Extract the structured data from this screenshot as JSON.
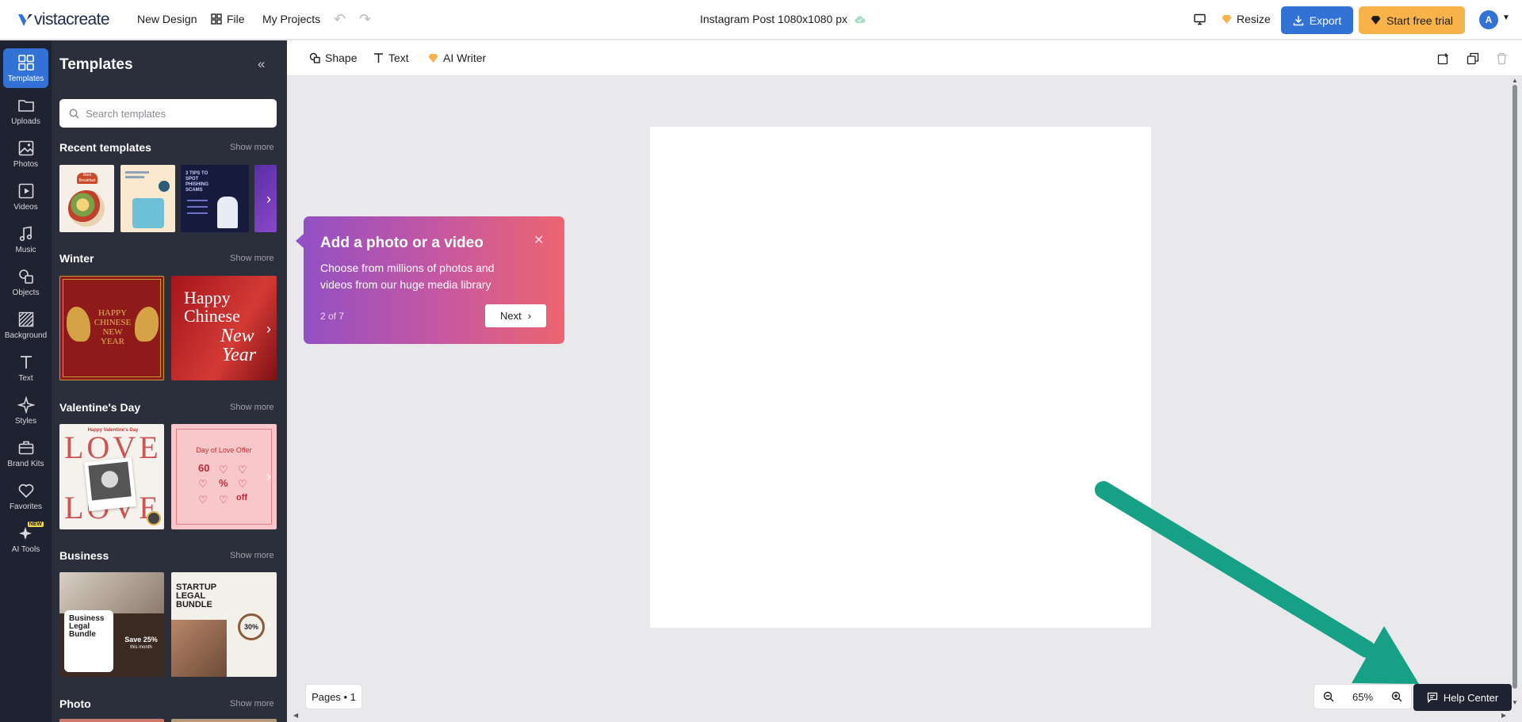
{
  "topbar": {
    "logo": "vistacreate",
    "new_design": "New Design",
    "file": "File",
    "my_projects": "My Projects",
    "doc_title": "Instagram Post 1080x1080 px",
    "resize": "Resize",
    "export": "Export",
    "trial": "Start free trial",
    "avatar": "A"
  },
  "rail": {
    "items": [
      {
        "label": "Templates"
      },
      {
        "label": "Uploads"
      },
      {
        "label": "Photos"
      },
      {
        "label": "Videos"
      },
      {
        "label": "Music"
      },
      {
        "label": "Objects"
      },
      {
        "label": "Background"
      },
      {
        "label": "Text"
      },
      {
        "label": "Styles"
      },
      {
        "label": "Brand Kits"
      },
      {
        "label": "Favorites"
      },
      {
        "label": "AI Tools"
      }
    ],
    "new_badge": "NEW"
  },
  "panel": {
    "title": "Templates",
    "search_placeholder": "Search templates",
    "show_more": "Show more",
    "sections": [
      {
        "title": "Recent templates"
      },
      {
        "title": "Winter"
      },
      {
        "title": "Valentine's Day"
      },
      {
        "title": "Business"
      },
      {
        "title": "Photo"
      }
    ],
    "thumb_text": {
      "recent1": "Best Breakfast",
      "recent3": "3 TIPS TO SPOT PHISHING SCAMS",
      "winter1": "HAPPY CHINESE NEW YEAR",
      "winter2a": "Happy",
      "winter2b": "Chinese",
      "winter2c": "New",
      "winter2d": "Year",
      "val1": "Happy Valentine's Day",
      "val1b": "LOVE",
      "val2": "Day of Love Offer",
      "val2n1": "60",
      "val2n2": "%",
      "val2n3": "off",
      "biz1": "Business Legal Bundle",
      "biz1b": "Save 25%",
      "biz1c": "this month",
      "biz2": "STARTUP LEGAL BUNDLE",
      "biz2b": "30%"
    }
  },
  "toolbar": {
    "shape": "Shape",
    "text": "Text",
    "ai_writer": "AI Writer"
  },
  "popover": {
    "title": "Add a photo or a video",
    "body": "Choose from millions of photos and videos from our huge media library",
    "step": "2 of 7",
    "next": "Next"
  },
  "bottom": {
    "pages": "Pages • 1",
    "zoom": "65%",
    "help": "Help Center"
  },
  "colors": {
    "accent": "#3172d4",
    "trial": "#f7b249",
    "annotation_arrow": "#16a085"
  }
}
